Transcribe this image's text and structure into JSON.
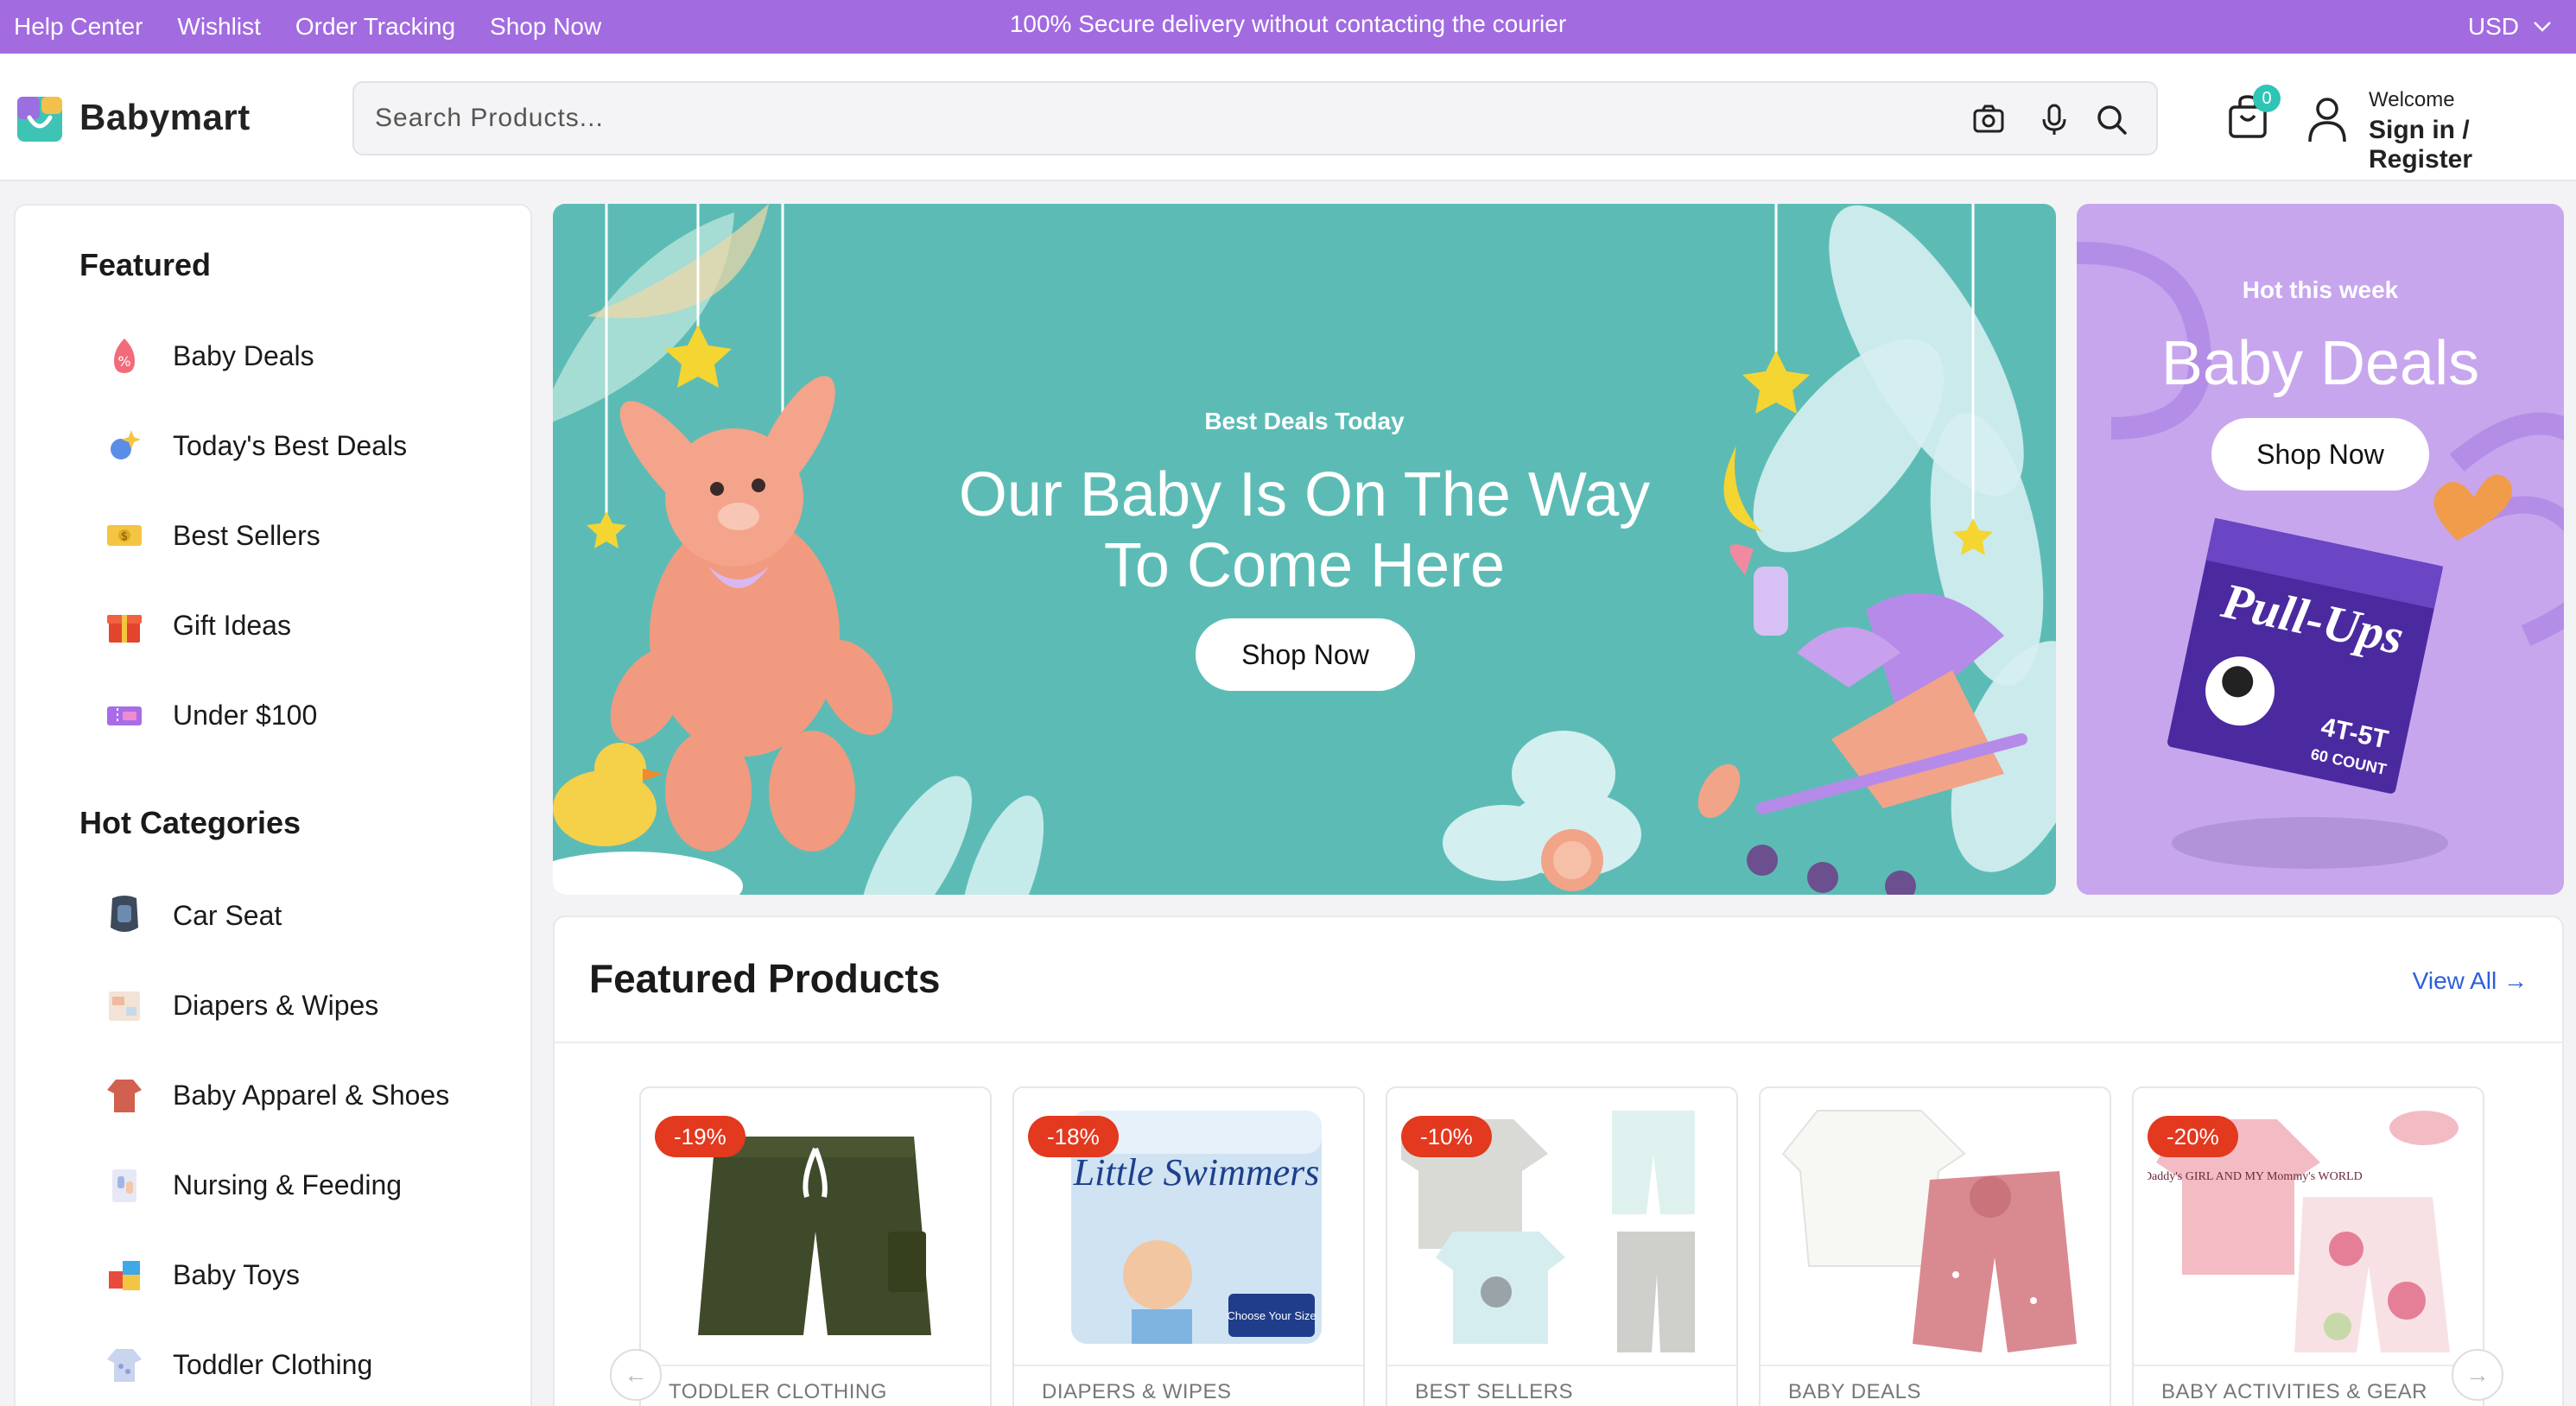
{
  "topbar": {
    "links": [
      "Help Center",
      "Wishlist",
      "Order Tracking",
      "Shop Now"
    ],
    "announcement": "100% Secure delivery without contacting the courier",
    "currency": "USD"
  },
  "header": {
    "logo_text": "Babymart",
    "search_placeholder": "Search Products...",
    "cart_count": "0",
    "welcome": "Welcome",
    "signin": "Sign in / Register"
  },
  "sidebar": {
    "featured_title": "Featured",
    "featured_items": [
      {
        "label": "Baby Deals",
        "icon": "percent-tag-icon"
      },
      {
        "label": "Today's Best Deals",
        "icon": "sparkle-icon"
      },
      {
        "label": "Best Sellers",
        "icon": "money-icon"
      },
      {
        "label": "Gift Ideas",
        "icon": "gift-icon"
      },
      {
        "label": "Under $100",
        "icon": "ticket-icon"
      }
    ],
    "hot_title": "Hot Categories",
    "hot_items": [
      {
        "label": "Car Seat"
      },
      {
        "label": "Diapers & Wipes"
      },
      {
        "label": "Baby Apparel & Shoes"
      },
      {
        "label": "Nursing & Feeding"
      },
      {
        "label": "Baby Toys"
      },
      {
        "label": "Toddler Clothing"
      }
    ]
  },
  "hero": {
    "subtitle": "Best Deals Today",
    "title_line1": "Our Baby Is On The Way",
    "title_line2": "To Come Here",
    "button": "Shop Now"
  },
  "promo": {
    "subtitle": "Hot this week",
    "title": "Baby Deals",
    "button": "Shop Now",
    "product_brand": "Pull-Ups",
    "product_size": "4T-5T",
    "product_count": "60 COUNT"
  },
  "featured": {
    "title": "Featured Products",
    "view_all": "View All →",
    "products": [
      {
        "badge": "-19%",
        "category": "TODDLER CLOTHING"
      },
      {
        "badge": "-18%",
        "category": "DIAPERS & WIPES",
        "brand_text": "Little Swimmers",
        "chip": "Choose Your Size"
      },
      {
        "badge": "-10%",
        "category": "BEST SELLERS"
      },
      {
        "badge": "",
        "category": "BABY DEALS"
      },
      {
        "badge": "-20%",
        "category": "BABY ACTIVITIES & GEAR",
        "shirt_text": "I MY Daddy's GIRL AND MY Mommy's WORLD"
      }
    ]
  },
  "colors": {
    "topbar": "#a26be0",
    "hero_bg": "#5cbcb5",
    "promo_bg": "#c7a6ee",
    "badge": "#e2391f",
    "link": "#2b5fd9",
    "cart_badge": "#2ec5b6"
  }
}
